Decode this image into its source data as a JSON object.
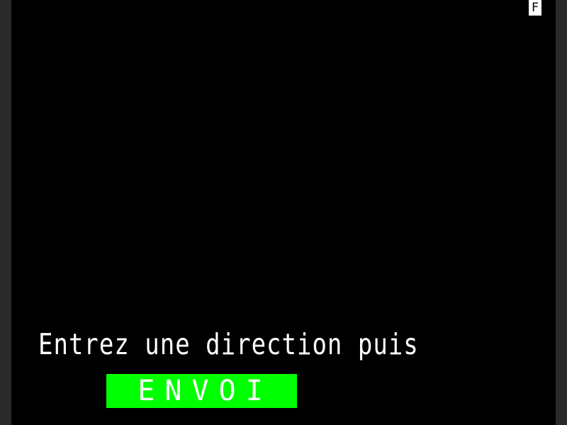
{
  "status": {
    "indicator": "F"
  },
  "prompt": {
    "text": "Entrez une direction puis"
  },
  "send_key": {
    "label": "ENVOI"
  },
  "colors": {
    "background": "#000000",
    "text": "#ffffff",
    "send_key_background": "#00ff00",
    "indicator_background": "#ffffff"
  }
}
